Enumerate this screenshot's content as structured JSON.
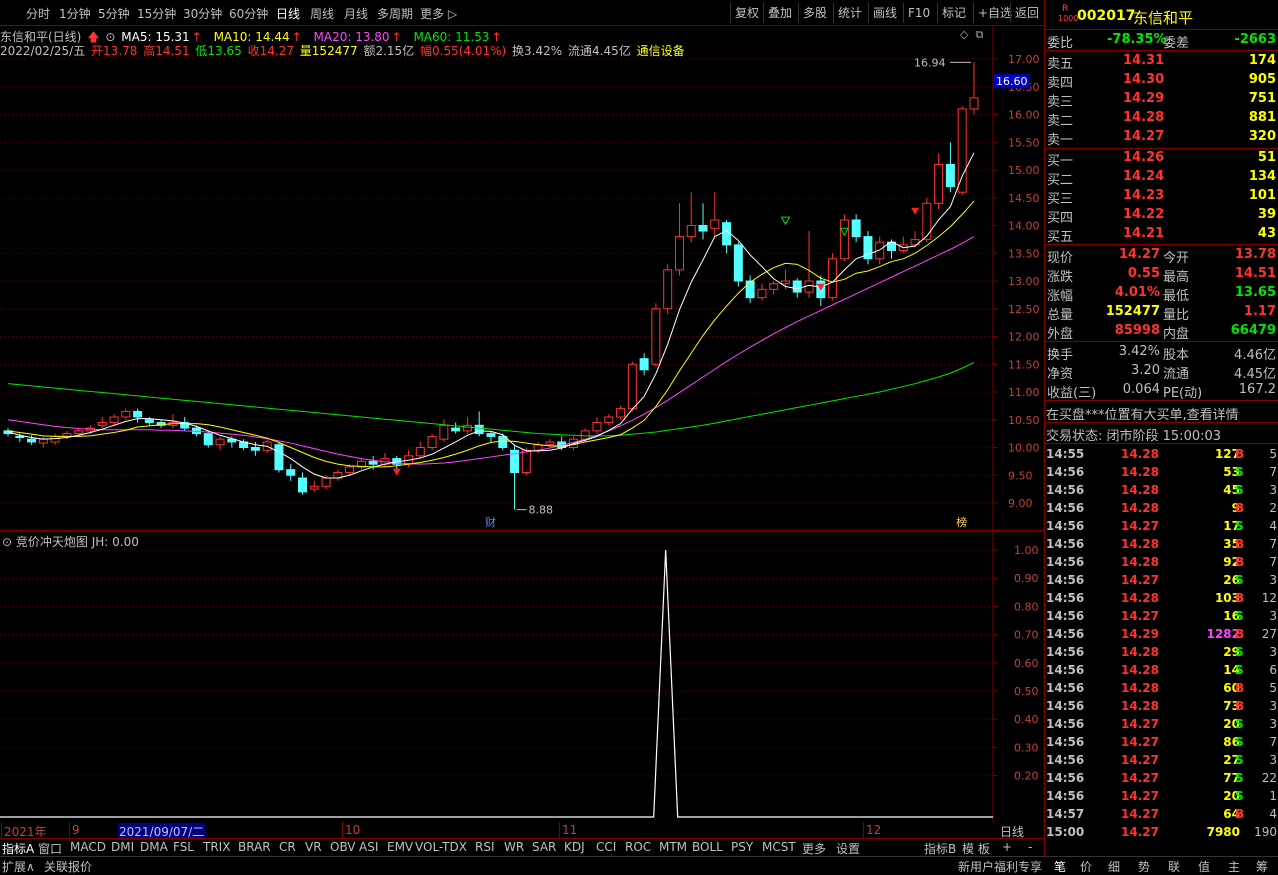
{
  "toolbar": {
    "periods": [
      "分时",
      "1分钟",
      "5分钟",
      "15分钟",
      "30分钟",
      "60分钟",
      "日线",
      "周线",
      "月线",
      "多周期",
      "更多"
    ],
    "right_buttons": [
      "复权",
      "叠加",
      "多股",
      "统计",
      "画线",
      "F10",
      "标记",
      "+自选",
      "返回"
    ]
  },
  "chart_header": {
    "stock_name": "东信和平(日线)",
    "ma5": "MA5: 15.31",
    "ma10": "MA10: 14.44",
    "ma20": "MA20: 13.80",
    "ma60": "MA60: 11.53",
    "date": "2022/02/25/五",
    "open": "开13.78",
    "high": "高14.51",
    "low": "低13.65",
    "close": "收14.27",
    "volume": "量152477",
    "amount": "额2.15亿",
    "change": "幅0.55(4.01%)",
    "turnover": "换3.42%",
    "float_cap": "流通4.45亿",
    "industry": "通信设备",
    "colors": {
      "ma5": "#ffffff",
      "ma10": "#ffff00",
      "ma20": "#ff44ff",
      "ma60": "#00e600"
    }
  },
  "chart_data": {
    "type": "candlestick",
    "ylim": [
      8.6,
      17.2
    ],
    "yticks": [
      "17.00",
      "16.50",
      "16.00",
      "15.50",
      "15.00",
      "14.50",
      "14.00",
      "13.50",
      "13.00",
      "12.50",
      "12.00",
      "11.50",
      "11.00",
      "10.50",
      "10.00",
      "9.50",
      "9.00"
    ],
    "yticks_values": [
      17.0,
      16.5,
      16.0,
      15.5,
      15.0,
      14.5,
      14.0,
      13.5,
      13.0,
      12.5,
      12.0,
      11.5,
      11.0,
      10.5,
      10.0,
      9.5,
      9.0
    ],
    "current_price_tag": "16.60",
    "high_annotation": "16.94",
    "low_annotation": "8.88",
    "markers": [
      "财",
      "榜"
    ],
    "candles": [
      [
        10.3,
        10.25,
        10.35,
        10.2
      ],
      [
        10.2,
        10.18,
        10.25,
        10.1
      ],
      [
        10.15,
        10.1,
        10.22,
        10.05
      ],
      [
        10.08,
        10.15,
        10.2,
        10.0
      ],
      [
        10.1,
        10.2,
        10.25,
        10.05
      ],
      [
        10.2,
        10.25,
        10.3,
        10.15
      ],
      [
        10.25,
        10.3,
        10.35,
        10.2
      ],
      [
        10.3,
        10.35,
        10.4,
        10.25
      ],
      [
        10.4,
        10.45,
        10.55,
        10.35
      ],
      [
        10.45,
        10.55,
        10.6,
        10.4
      ],
      [
        10.55,
        10.65,
        10.7,
        10.5
      ],
      [
        10.65,
        10.55,
        10.7,
        10.45
      ],
      [
        10.5,
        10.45,
        10.55,
        10.4
      ],
      [
        10.45,
        10.4,
        10.5,
        10.35
      ],
      [
        10.4,
        10.45,
        10.6,
        10.35
      ],
      [
        10.45,
        10.35,
        10.55,
        10.3
      ],
      [
        10.35,
        10.25,
        10.4,
        10.2
      ],
      [
        10.25,
        10.05,
        10.3,
        10.0
      ],
      [
        10.05,
        10.15,
        10.2,
        9.95
      ],
      [
        10.15,
        10.1,
        10.2,
        10.0
      ],
      [
        10.1,
        10.0,
        10.15,
        9.95
      ],
      [
        10.0,
        9.95,
        10.1,
        9.85
      ],
      [
        9.95,
        10.1,
        10.15,
        9.9
      ],
      [
        10.05,
        9.6,
        10.1,
        9.55
      ],
      [
        9.6,
        9.5,
        9.7,
        9.4
      ],
      [
        9.45,
        9.2,
        9.55,
        9.15
      ],
      [
        9.25,
        9.3,
        9.4,
        9.2
      ],
      [
        9.3,
        9.45,
        9.5,
        9.25
      ],
      [
        9.45,
        9.55,
        9.6,
        9.4
      ],
      [
        9.55,
        9.65,
        9.7,
        9.5
      ],
      [
        9.65,
        9.75,
        9.8,
        9.6
      ],
      [
        9.75,
        9.7,
        9.85,
        9.6
      ],
      [
        9.7,
        9.8,
        9.9,
        9.65
      ],
      [
        9.8,
        9.7,
        9.85,
        9.6
      ],
      [
        9.7,
        9.85,
        9.95,
        9.65
      ],
      [
        9.85,
        10.0,
        10.1,
        9.8
      ],
      [
        10.0,
        10.2,
        10.25,
        9.95
      ],
      [
        10.15,
        10.4,
        10.5,
        10.1
      ],
      [
        10.35,
        10.3,
        10.45,
        10.25
      ],
      [
        10.3,
        10.4,
        10.55,
        10.25
      ],
      [
        10.4,
        10.25,
        10.65,
        10.2
      ],
      [
        10.25,
        10.2,
        10.3,
        10.1
      ],
      [
        10.2,
        10.0,
        10.25,
        9.95
      ],
      [
        9.95,
        9.55,
        10.05,
        8.88
      ],
      [
        9.55,
        9.95,
        10.0,
        9.5
      ],
      [
        9.95,
        10.05,
        10.1,
        9.9
      ],
      [
        10.05,
        10.1,
        10.15,
        10.0
      ],
      [
        10.1,
        10.0,
        10.2,
        9.95
      ],
      [
        10.0,
        10.15,
        10.2,
        9.95
      ],
      [
        10.15,
        10.3,
        10.35,
        10.1
      ],
      [
        10.3,
        10.45,
        10.55,
        10.25
      ],
      [
        10.45,
        10.55,
        10.6,
        10.4
      ],
      [
        10.55,
        10.7,
        10.75,
        10.5
      ],
      [
        10.7,
        11.5,
        11.55,
        10.65
      ],
      [
        11.6,
        11.4,
        11.7,
        11.3
      ],
      [
        11.5,
        12.5,
        12.6,
        11.45
      ],
      [
        12.5,
        13.2,
        13.3,
        12.4
      ],
      [
        13.2,
        13.8,
        14.4,
        13.1
      ],
      [
        13.8,
        14.0,
        14.6,
        13.7
      ],
      [
        14.0,
        13.9,
        14.4,
        13.75
      ],
      [
        13.95,
        14.1,
        14.6,
        13.8
      ],
      [
        14.05,
        13.65,
        14.1,
        13.5
      ],
      [
        13.65,
        13.0,
        13.7,
        12.9
      ],
      [
        13.0,
        12.7,
        13.1,
        12.6
      ],
      [
        12.7,
        12.85,
        12.95,
        12.65
      ],
      [
        12.85,
        12.95,
        13.0,
        12.75
      ],
      [
        12.95,
        13.0,
        13.2,
        12.85
      ],
      [
        13.0,
        12.8,
        13.05,
        12.7
      ],
      [
        12.8,
        13.0,
        13.9,
        12.7
      ],
      [
        13.0,
        12.7,
        13.1,
        12.55
      ],
      [
        12.7,
        13.4,
        13.5,
        12.65
      ],
      [
        13.4,
        14.1,
        14.2,
        13.35
      ],
      [
        14.1,
        13.8,
        14.2,
        13.7
      ],
      [
        13.8,
        13.4,
        13.9,
        13.3
      ],
      [
        13.4,
        13.7,
        13.8,
        13.3
      ],
      [
        13.7,
        13.55,
        13.75,
        13.4
      ],
      [
        13.55,
        13.65,
        13.8,
        13.5
      ],
      [
        13.65,
        13.75,
        13.9,
        13.6
      ],
      [
        13.75,
        14.4,
        14.5,
        13.7
      ],
      [
        14.4,
        15.1,
        15.3,
        14.3
      ],
      [
        15.1,
        14.7,
        15.5,
        14.6
      ],
      [
        14.6,
        16.1,
        16.15,
        14.55
      ],
      [
        16.1,
        16.3,
        16.94,
        16.0
      ]
    ],
    "ma5": [
      10.28,
      10.22,
      10.18,
      10.15,
      10.16,
      10.18,
      10.22,
      10.27,
      10.33,
      10.4,
      10.47,
      10.52,
      10.52,
      10.5,
      10.48,
      10.44,
      10.38,
      10.3,
      10.22,
      10.16,
      10.1,
      10.05,
      10.02,
      9.92,
      9.8,
      9.65,
      9.52,
      9.45,
      9.45,
      9.5,
      9.58,
      9.65,
      9.7,
      9.74,
      9.77,
      9.81,
      9.88,
      9.99,
      10.1,
      10.22,
      10.3,
      10.29,
      10.23,
      10.04,
      9.94,
      9.94,
      9.95,
      9.99,
      10.07,
      10.13,
      10.2,
      10.31,
      10.43,
      10.69,
      10.92,
      11.33,
      11.86,
      12.48,
      12.98,
      13.38,
      13.8,
      13.91,
      13.73,
      13.47,
      13.26,
      13.04,
      12.9,
      12.86,
      12.92,
      12.89,
      12.98,
      13.2,
      13.4,
      13.48,
      13.56,
      13.71,
      13.6,
      13.63,
      13.81,
      14.1,
      14.34,
      14.89,
      15.31
    ],
    "ma10": [
      10.3,
      10.27,
      10.24,
      10.21,
      10.2,
      10.2,
      10.2,
      10.21,
      10.24,
      10.27,
      10.31,
      10.37,
      10.39,
      10.41,
      10.43,
      10.43,
      10.43,
      10.41,
      10.37,
      10.32,
      10.27,
      10.22,
      10.17,
      10.09,
      10.0,
      9.91,
      9.82,
      9.75,
      9.7,
      9.67,
      9.66,
      9.65,
      9.65,
      9.67,
      9.7,
      9.73,
      9.77,
      9.82,
      9.88,
      9.95,
      10.03,
      10.09,
      10.12,
      10.11,
      10.08,
      10.05,
      10.03,
      10.03,
      10.05,
      10.1,
      10.14,
      10.18,
      10.23,
      10.35,
      10.49,
      10.74,
      11.04,
      11.38,
      11.7,
      12.02,
      12.3,
      12.55,
      12.78,
      12.98,
      13.12,
      13.24,
      13.32,
      13.3,
      13.19,
      13.05,
      12.98,
      13.03,
      13.14,
      13.18,
      13.26,
      13.35,
      13.4,
      13.5,
      13.64,
      13.8,
      13.98,
      14.2,
      14.44
    ],
    "ma20": [
      10.5,
      10.47,
      10.44,
      10.41,
      10.38,
      10.36,
      10.34,
      10.33,
      10.32,
      10.32,
      10.32,
      10.32,
      10.32,
      10.31,
      10.31,
      10.3,
      10.29,
      10.28,
      10.26,
      10.24,
      10.22,
      10.19,
      10.16,
      10.12,
      10.08,
      10.03,
      9.98,
      9.93,
      9.88,
      9.84,
      9.8,
      9.77,
      9.74,
      9.72,
      9.71,
      9.7,
      9.71,
      9.72,
      9.74,
      9.77,
      9.8,
      9.83,
      9.86,
      9.89,
      9.92,
      9.95,
      9.99,
      10.04,
      10.09,
      10.15,
      10.22,
      10.3,
      10.39,
      10.49,
      10.6,
      10.72,
      10.85,
      10.99,
      11.13,
      11.27,
      11.41,
      11.55,
      11.68,
      11.81,
      11.93,
      12.05,
      12.16,
      12.27,
      12.37,
      12.47,
      12.57,
      12.67,
      12.77,
      12.87,
      12.97,
      13.07,
      13.17,
      13.27,
      13.37,
      13.47,
      13.57,
      13.68,
      13.8
    ],
    "ma60": [
      11.15,
      11.13,
      11.11,
      11.09,
      11.07,
      11.05,
      11.03,
      11.01,
      10.99,
      10.97,
      10.95,
      10.93,
      10.91,
      10.89,
      10.87,
      10.85,
      10.83,
      10.81,
      10.79,
      10.77,
      10.75,
      10.73,
      10.71,
      10.69,
      10.67,
      10.65,
      10.63,
      10.61,
      10.59,
      10.57,
      10.55,
      10.53,
      10.51,
      10.49,
      10.47,
      10.45,
      10.43,
      10.41,
      10.39,
      10.37,
      10.35,
      10.33,
      10.31,
      10.29,
      10.27,
      10.25,
      10.24,
      10.23,
      10.22,
      10.21,
      10.21,
      10.21,
      10.22,
      10.24,
      10.26,
      10.28,
      10.31,
      10.34,
      10.37,
      10.4,
      10.44,
      10.48,
      10.52,
      10.56,
      10.6,
      10.64,
      10.68,
      10.72,
      10.76,
      10.8,
      10.84,
      10.88,
      10.92,
      10.96,
      11.0,
      11.05,
      11.1,
      11.15,
      11.21,
      11.27,
      11.34,
      11.43,
      11.53
    ]
  },
  "sub_chart": {
    "title": "竞价冲天炮图",
    "jh": "JH: 0.00",
    "yticks": [
      "1.00",
      "0.90",
      "0.80",
      "0.70",
      "0.60",
      "0.50",
      "0.40",
      "0.30",
      "0.20"
    ],
    "yticks_values": [
      1.0,
      0.9,
      0.8,
      0.7,
      0.6,
      0.5,
      0.4,
      0.3,
      0.2
    ],
    "spike_index": 56,
    "spike_value": 1.0
  },
  "date_axis": {
    "labels": [
      "2021年",
      "9",
      "2021/09/07/二",
      "10",
      "11",
      "12"
    ],
    "right_label": "日线"
  },
  "indicator_tabs": [
    "指标A",
    "窗口",
    "MACD",
    "DMI",
    "DMA",
    "FSL",
    "TRIX",
    "BRAR",
    "CR",
    "VR",
    "OBV",
    "ASI",
    "EMV",
    "VOL-TDX",
    "RSI",
    "WR",
    "SAR",
    "KDJ",
    "CCI",
    "ROC",
    "MTM",
    "BOLL",
    "PSY",
    "MCST",
    "更多",
    "设置"
  ],
  "indicator_right": [
    "指标B",
    "模 板",
    "+",
    "-"
  ],
  "statusbar": {
    "left": [
      "扩展∧",
      "关联报价"
    ],
    "promo": "新用户福利专享",
    "right_tabs": [
      "笔",
      "价",
      "细",
      "势",
      "联",
      "值",
      "主",
      "筹"
    ]
  },
  "quote": {
    "code": "002017",
    "name": "东信和平",
    "badge_top": "R",
    "badge_bottom": "1000",
    "weibi_label": "委比",
    "weibi": "-78.35%",
    "weicha_label": "委差",
    "weicha": "-2663",
    "sell": [
      {
        "label": "卖五",
        "price": "14.31",
        "vol": "174"
      },
      {
        "label": "卖四",
        "price": "14.30",
        "vol": "905"
      },
      {
        "label": "卖三",
        "price": "14.29",
        "vol": "751"
      },
      {
        "label": "卖二",
        "price": "14.28",
        "vol": "881"
      },
      {
        "label": "卖一",
        "price": "14.27",
        "vol": "320"
      }
    ],
    "buy": [
      {
        "label": "买一",
        "price": "14.26",
        "vol": "51"
      },
      {
        "label": "买二",
        "price": "14.24",
        "vol": "134"
      },
      {
        "label": "买三",
        "price": "14.23",
        "vol": "101"
      },
      {
        "label": "买四",
        "price": "14.22",
        "vol": "39"
      },
      {
        "label": "买五",
        "price": "14.21",
        "vol": "43"
      }
    ],
    "stats": [
      {
        "l1": "现价",
        "v1": "14.27",
        "c1": "red",
        "l2": "今开",
        "v2": "13.78",
        "c2": "red"
      },
      {
        "l1": "涨跌",
        "v1": "0.55",
        "c1": "red",
        "l2": "最高",
        "v2": "14.51",
        "c2": "red"
      },
      {
        "l1": "涨幅",
        "v1": "4.01%",
        "c1": "red",
        "l2": "最低",
        "v2": "13.65",
        "c2": "green"
      },
      {
        "l1": "总量",
        "v1": "152477",
        "c1": "yellow",
        "l2": "量比",
        "v2": "1.17",
        "c2": "red"
      },
      {
        "l1": "外盘",
        "v1": "85998",
        "c1": "red",
        "l2": "内盘",
        "v2": "66479",
        "c2": "green"
      }
    ],
    "stats2": [
      {
        "l1": "换手",
        "v1": "3.42%",
        "l2": "股本",
        "v2": "4.46亿"
      },
      {
        "l1": "净资",
        "v1": "3.20",
        "l2": "流通",
        "v2": "4.45亿"
      },
      {
        "l1": "收益(三)",
        "v1": "0.064",
        "l2": "PE(动)",
        "v2": "167.2"
      }
    ],
    "notice": "在买盘***位置有大买单,查看详情",
    "trade_status": "交易状态: 闭市阶段 15:00:03",
    "ticks": [
      {
        "t": "14:55",
        "p": "14.28",
        "v": "127",
        "d": "B",
        "n": "5"
      },
      {
        "t": "14:56",
        "p": "14.28",
        "v": "53",
        "d": "S",
        "n": "7"
      },
      {
        "t": "14:56",
        "p": "14.28",
        "v": "45",
        "d": "S",
        "n": "3"
      },
      {
        "t": "14:56",
        "p": "14.28",
        "v": "9",
        "d": "B",
        "n": "2"
      },
      {
        "t": "14:56",
        "p": "14.27",
        "v": "17",
        "d": "S",
        "n": "4"
      },
      {
        "t": "14:56",
        "p": "14.28",
        "v": "35",
        "d": "B",
        "n": "7"
      },
      {
        "t": "14:56",
        "p": "14.28",
        "v": "92",
        "d": "B",
        "n": "7"
      },
      {
        "t": "14:56",
        "p": "14.27",
        "v": "26",
        "d": "S",
        "n": "3"
      },
      {
        "t": "14:56",
        "p": "14.28",
        "v": "103",
        "d": "B",
        "n": "12"
      },
      {
        "t": "14:56",
        "p": "14.27",
        "v": "16",
        "d": "S",
        "n": "3"
      },
      {
        "t": "14:56",
        "p": "14.29",
        "v": "1282",
        "d": "B",
        "n": "27"
      },
      {
        "t": "14:56",
        "p": "14.28",
        "v": "29",
        "d": "S",
        "n": "3"
      },
      {
        "t": "14:56",
        "p": "14.28",
        "v": "14",
        "d": "S",
        "n": "6"
      },
      {
        "t": "14:56",
        "p": "14.28",
        "v": "60",
        "d": "B",
        "n": "5"
      },
      {
        "t": "14:56",
        "p": "14.28",
        "v": "73",
        "d": "B",
        "n": "3"
      },
      {
        "t": "14:56",
        "p": "14.27",
        "v": "20",
        "d": "S",
        "n": "3"
      },
      {
        "t": "14:56",
        "p": "14.27",
        "v": "86",
        "d": "S",
        "n": "7"
      },
      {
        "t": "14:56",
        "p": "14.27",
        "v": "27",
        "d": "S",
        "n": "3"
      },
      {
        "t": "14:56",
        "p": "14.27",
        "v": "77",
        "d": "S",
        "n": "22"
      },
      {
        "t": "14:56",
        "p": "14.27",
        "v": "20",
        "d": "S",
        "n": "1"
      },
      {
        "t": "14:57",
        "p": "14.27",
        "v": "64",
        "d": "B",
        "n": "4"
      },
      {
        "t": "15:00",
        "p": "14.27",
        "v": "7980",
        "d": "",
        "n": "190"
      }
    ]
  }
}
